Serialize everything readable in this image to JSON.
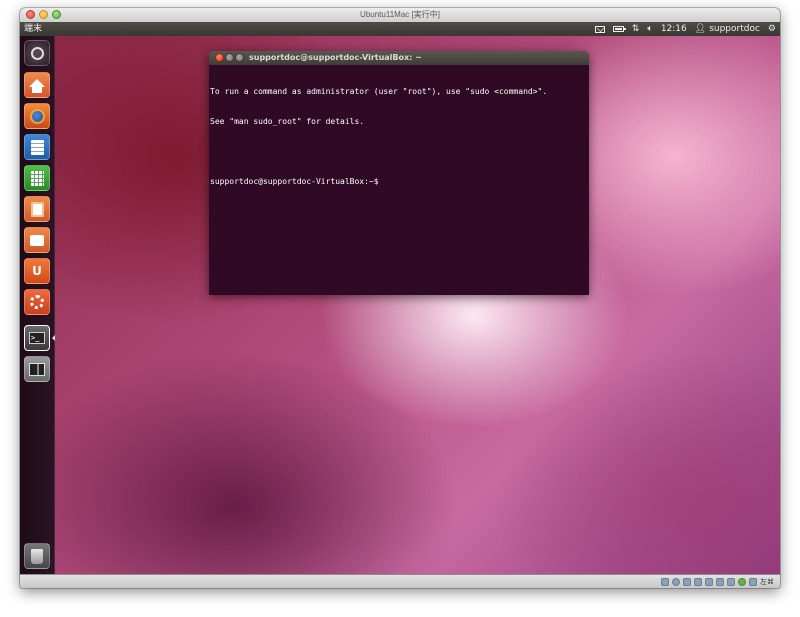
{
  "host_window": {
    "title": "Ubuntu11Mac [実行中]"
  },
  "top_panel": {
    "app_name": "端末",
    "clock": "12:16",
    "username": "supportdoc",
    "indicators": [
      "mail-icon",
      "battery-icon",
      "network-icon",
      "volume-icon",
      "user-icon",
      "gear-icon"
    ]
  },
  "launcher": {
    "items": [
      {
        "name": "dash-home",
        "icon": "ubuntu-logo-icon"
      },
      {
        "name": "home-folder",
        "icon": "home-folder-icon"
      },
      {
        "name": "firefox",
        "icon": "firefox-icon"
      },
      {
        "name": "libreoffice-writer",
        "icon": "writer-icon"
      },
      {
        "name": "libreoffice-calc",
        "icon": "calc-icon"
      },
      {
        "name": "libreoffice-impress",
        "icon": "impress-icon"
      },
      {
        "name": "ubuntu-software-center",
        "icon": "software-center-icon"
      },
      {
        "name": "ubuntu-one",
        "icon": "ubuntu-one-icon",
        "glyph": "U"
      },
      {
        "name": "system-settings",
        "icon": "settings-icon"
      },
      {
        "name": "terminal",
        "icon": "terminal-icon",
        "glyph": ">_"
      },
      {
        "name": "workspace-switcher",
        "icon": "workspaces-icon"
      },
      {
        "name": "trash",
        "icon": "trash-icon"
      }
    ]
  },
  "terminal": {
    "title": "supportdoc@supportdoc-VirtualBox: ~",
    "lines": [
      "To run a command as administrator (user \"root\"), use \"sudo <command>\".",
      "See \"man sudo_root\" for details.",
      "",
      "supportdoc@supportdoc-VirtualBox:~$"
    ]
  },
  "status_bar": {
    "host_key_label": "左⌘"
  }
}
